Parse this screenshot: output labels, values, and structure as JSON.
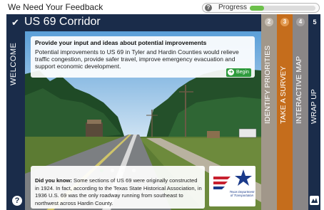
{
  "survey": {
    "title": "We Need Your Feedback"
  },
  "progress": {
    "label": "Progress",
    "help_icon": "question-icon",
    "fraction": 0.22
  },
  "header": {
    "check_icon": "check-icon",
    "title": "US 69 Corridor"
  },
  "welcome_tab": {
    "label": "WELCOME"
  },
  "intro": {
    "title": "Provide your input and ideas about potential improvements",
    "body": "Potential improvements to US 69 in Tyler and Hardin Counties would relieve traffic congestion, provide safer travel, improve emergency evacuation and support economic development.",
    "begin_label": "Begin",
    "begin_icon": "arrow-right-icon"
  },
  "carousel": {
    "dot_count": 4,
    "active_index": 0
  },
  "fact": {
    "lead": "Did you know:",
    "text": " Some sections of US 69 were originally constructed in 1924. In fact, according to the Texas State Historical Association, in 1936 U.S. 69 was the only roadway running from southeast to northwest across Hardin County."
  },
  "logo": {
    "name": "Texas Department of Transportation"
  },
  "tabs": [
    {
      "number": "2",
      "label": "IDENTIFY PRIORITIES",
      "color": "#a1978a"
    },
    {
      "number": "3",
      "label": "TAKE A SURVEY",
      "color": "#c56d1c"
    },
    {
      "number": "4",
      "label": "INTERACTIVE MAP",
      "color": "#8a8686"
    },
    {
      "number": "5",
      "label": "WRAP UP",
      "color": "#1a2c4a"
    }
  ],
  "help": {
    "label": "?"
  },
  "colors": {
    "navy": "#1a2c4a",
    "green": "#2e9a3c",
    "progress_green": "#6cc04a"
  }
}
